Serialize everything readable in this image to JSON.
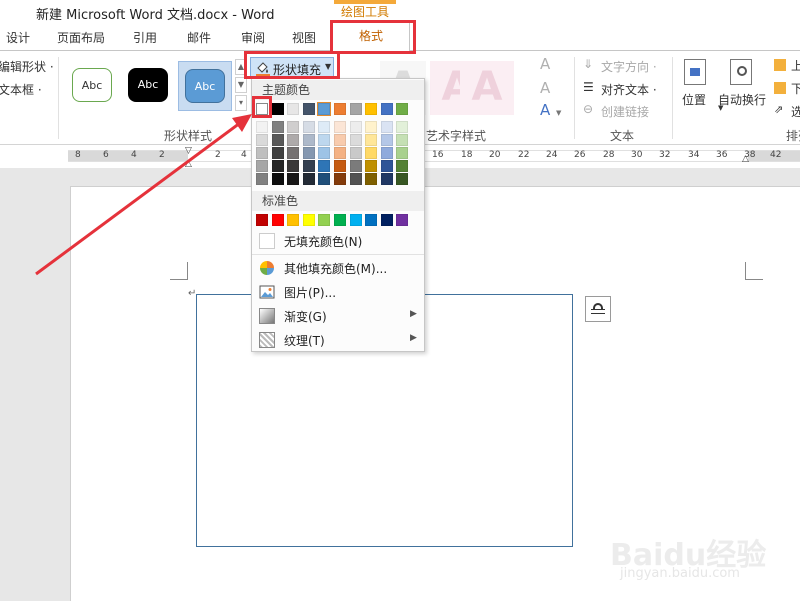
{
  "window": {
    "title": "新建 Microsoft Word 文档.docx - Word",
    "context_tab": "绘图工具"
  },
  "tabs": [
    "设计",
    "页面布局",
    "引用",
    "邮件",
    "审阅",
    "视图"
  ],
  "active_tab": "格式",
  "ribbon": {
    "left_items": [
      "编辑形状 ·",
      "文本框 ·"
    ],
    "shape_styles": {
      "label": "形状样式",
      "presets": [
        "Abc",
        "Abc",
        "Abc"
      ]
    },
    "shape_fill_button": "形状填充",
    "wordart": {
      "label": "艺术字样式",
      "letter": "A"
    },
    "text_group": {
      "label": "文本",
      "items": [
        "文字方向 ·",
        "对齐文本 ·",
        "创建链接"
      ]
    },
    "arrange_group": {
      "label": "排列",
      "position": "位置",
      "wrap": "自动换行",
      "partial": [
        "上",
        "下",
        "选"
      ]
    }
  },
  "ruler": {
    "ticks": [
      "8",
      "6",
      "4",
      "2",
      "2",
      "4",
      "16",
      "18",
      "20",
      "22",
      "24",
      "26",
      "28",
      "30",
      "32",
      "34",
      "36",
      "38",
      "40",
      "42"
    ]
  },
  "dropdown": {
    "theme_colors_label": "主题颜色",
    "theme_top_row": [
      "#ffffff",
      "#000000",
      "#e7e6e6",
      "#44546a",
      "#5b9bd5",
      "#ed7d31",
      "#a5a5a5",
      "#ffc000",
      "#4472c4",
      "#70ad47"
    ],
    "theme_shades": [
      [
        "#f2f2f2",
        "#d9d9d9",
        "#bfbfbf",
        "#a6a6a6",
        "#808080"
      ],
      [
        "#808080",
        "#595959",
        "#404040",
        "#262626",
        "#0d0d0d"
      ],
      [
        "#d0cece",
        "#aeaaaa",
        "#757171",
        "#3a3838",
        "#171616"
      ],
      [
        "#d6dce5",
        "#adb9ca",
        "#8497b0",
        "#333f50",
        "#222a35"
      ],
      [
        "#deebf7",
        "#bdd7ee",
        "#9dc3e6",
        "#2e75b6",
        "#1f4e79"
      ],
      [
        "#fbe5d6",
        "#f8cbad",
        "#f4b183",
        "#c55a11",
        "#843c0c"
      ],
      [
        "#ededed",
        "#dbdbdb",
        "#c9c9c9",
        "#7b7b7b",
        "#525252"
      ],
      [
        "#fff2cc",
        "#ffe699",
        "#ffd966",
        "#bf9000",
        "#7f6000"
      ],
      [
        "#dae3f3",
        "#b4c7e7",
        "#8faadc",
        "#2f5597",
        "#203864"
      ],
      [
        "#e2f0d9",
        "#c5e0b4",
        "#a9d18e",
        "#548235",
        "#385723"
      ]
    ],
    "standard_colors_label": "标准色",
    "standard_colors": [
      "#c00000",
      "#ff0000",
      "#ffc000",
      "#ffff00",
      "#92d050",
      "#00b050",
      "#00b0f0",
      "#0070c0",
      "#002060",
      "#7030a0"
    ],
    "no_fill": "无填充颜色(N)",
    "more_colors": "其他填充颜色(M)...",
    "picture": "图片(P)...",
    "gradient": "渐变(G)",
    "texture": "纹理(T)"
  },
  "watermark": {
    "brand": "Baidu经验",
    "url": "jingyan.baidu.com"
  },
  "colors": {
    "annotation_red": "#e5323b",
    "accent_orange": "#d17b00",
    "shape_border": "#41719c"
  }
}
